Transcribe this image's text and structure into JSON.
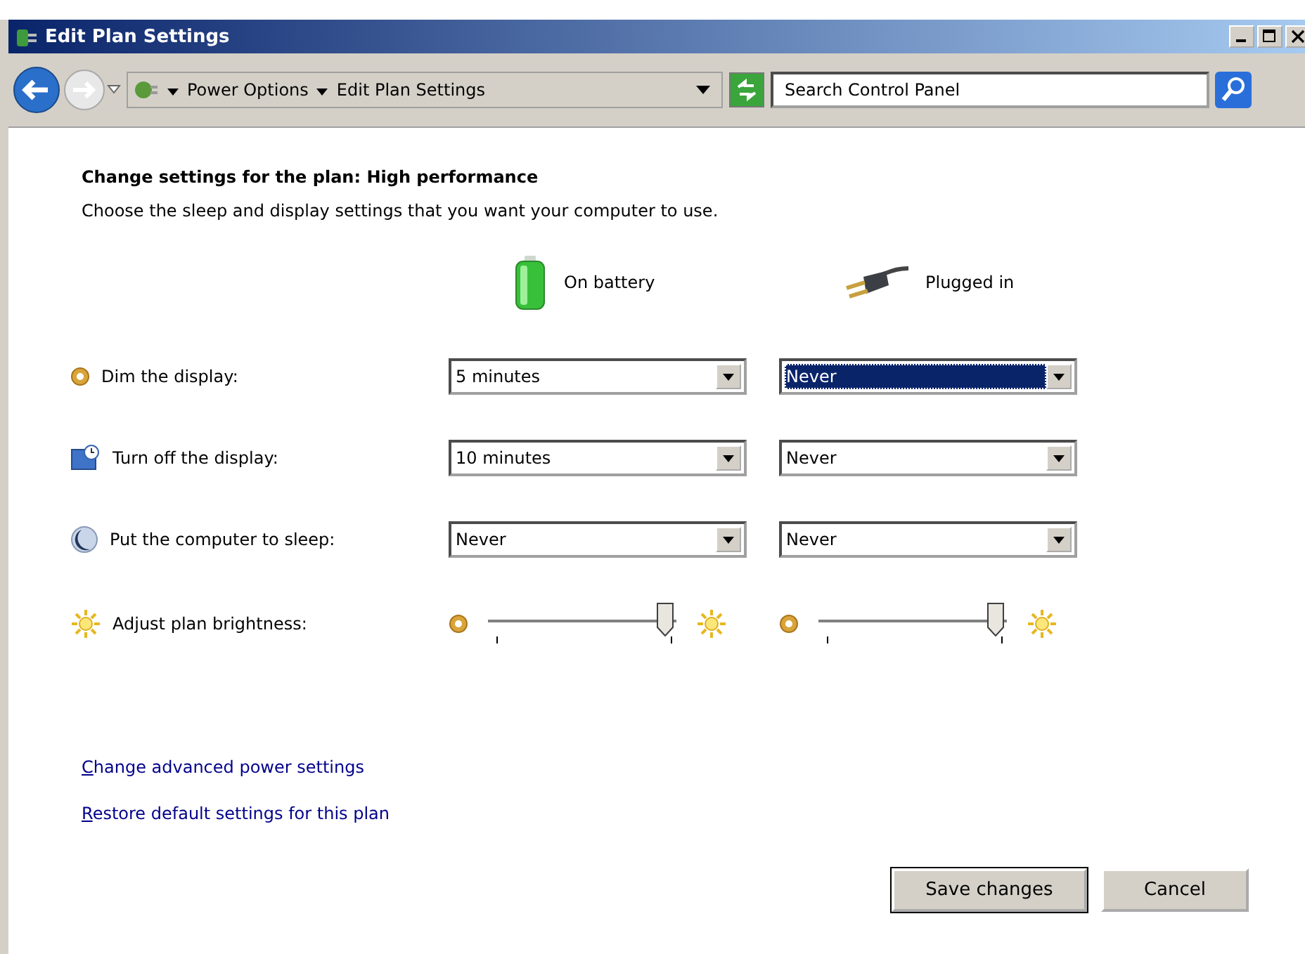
{
  "window": {
    "title": "Edit Plan Settings"
  },
  "address_bar": {
    "crumbs": [
      "Power Options",
      "Edit Plan Settings"
    ]
  },
  "search": {
    "placeholder": "Search Control Panel"
  },
  "heading": "Change settings for the plan: High performance",
  "description": "Choose the sleep and display settings that you want your computer to use.",
  "columns": [
    "On battery",
    "Plugged in"
  ],
  "settings": [
    {
      "kind": "dropdown",
      "label": "Dim the display:",
      "values": [
        {
          "value": "5 minutes",
          "focused": false
        },
        {
          "value": "Never",
          "focused": true
        }
      ]
    },
    {
      "kind": "dropdown",
      "label": "Turn off the display:",
      "values": [
        {
          "value": "10 minutes",
          "focused": false
        },
        {
          "value": "Never",
          "focused": false
        }
      ]
    },
    {
      "kind": "dropdown",
      "label": "Put the computer to sleep:",
      "values": [
        {
          "value": "Never",
          "focused": false
        },
        {
          "value": "Never",
          "focused": false
        }
      ]
    },
    {
      "kind": "slider",
      "label": "Adjust plan brightness:",
      "values": [
        {
          "level": 0.97
        },
        {
          "level": 0.97
        }
      ]
    }
  ],
  "links": [
    "Change advanced power settings",
    "Restore default settings for this plan"
  ],
  "buttons": [
    {
      "label": "Save changes",
      "default": true
    },
    {
      "label": "Cancel",
      "default": false
    }
  ]
}
